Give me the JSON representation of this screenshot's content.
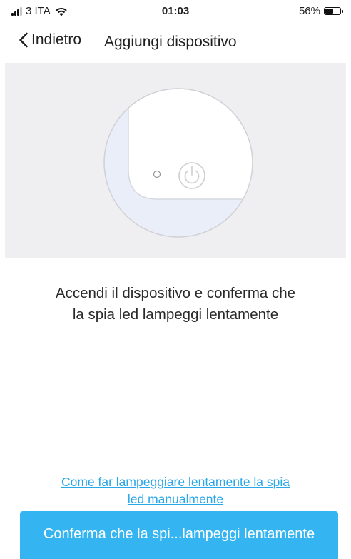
{
  "status_bar": {
    "carrier": "3 ITA",
    "time": "01:03",
    "battery_percent": "56%",
    "battery_level": 0.56,
    "icons": [
      "signal-icon",
      "wifi-icon",
      "battery-icon"
    ]
  },
  "nav": {
    "back_label": "Indietro",
    "title": "Aggiungi dispositivo",
    "back_icon": "chevron-left-icon"
  },
  "illustration": {
    "icons": [
      "led-indicator-icon",
      "power-icon"
    ],
    "colors": {
      "panel_background": "#efeff2",
      "circle_fill": "#ffffff",
      "device_body": "#e9eef8",
      "outline": "#d0d0d5"
    }
  },
  "instruction": {
    "line1": "Accendi il dispositivo e conferma che",
    "line2": "la spia led lampeggi lentamente"
  },
  "help_link": {
    "line1": "Come far lampeggiare lentamente la spia",
    "line2": "led manualmente"
  },
  "confirm_button": {
    "label": "Conferma che la spi...lampeggi lentamente"
  },
  "colors": {
    "accent": "#34b4f0",
    "link": "#2aa7e8",
    "text": "#1f1f1f"
  }
}
